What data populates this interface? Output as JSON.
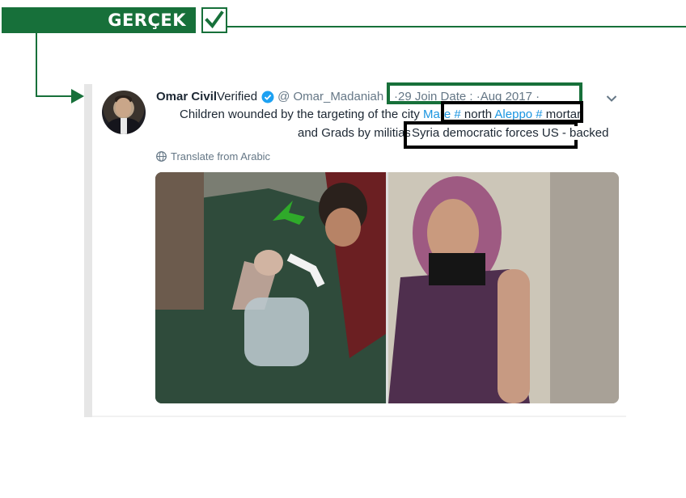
{
  "verdict": {
    "label": "GERÇEK",
    "check_glyph": "✓",
    "accent_color": "#17703a"
  },
  "tweet": {
    "display_name": "Omar Civil",
    "verified_text": "Verified",
    "handle": "@ Omar_Madaniah",
    "joined": "·29 Join Date :  ·Aug 2017 ·",
    "text_line1": {
      "a": "Children wounded by the targeting of the city ",
      "b": "Mare #",
      "c": " north ",
      "d": "Aleppo #",
      "e": " mortar"
    },
    "text_line2": {
      "a": "and Grads by militias ",
      "b": "Syria democratic forces US - backed"
    },
    "translate_label": "Translate from Arabic",
    "link_color": "#1b95e0"
  },
  "icons": {
    "verified": "verified-badge-icon",
    "chevron": "chevron-down-icon",
    "globe": "globe-icon",
    "arrow": "arrow-right-icon",
    "green_arrow": "arrow-down-left-icon"
  }
}
